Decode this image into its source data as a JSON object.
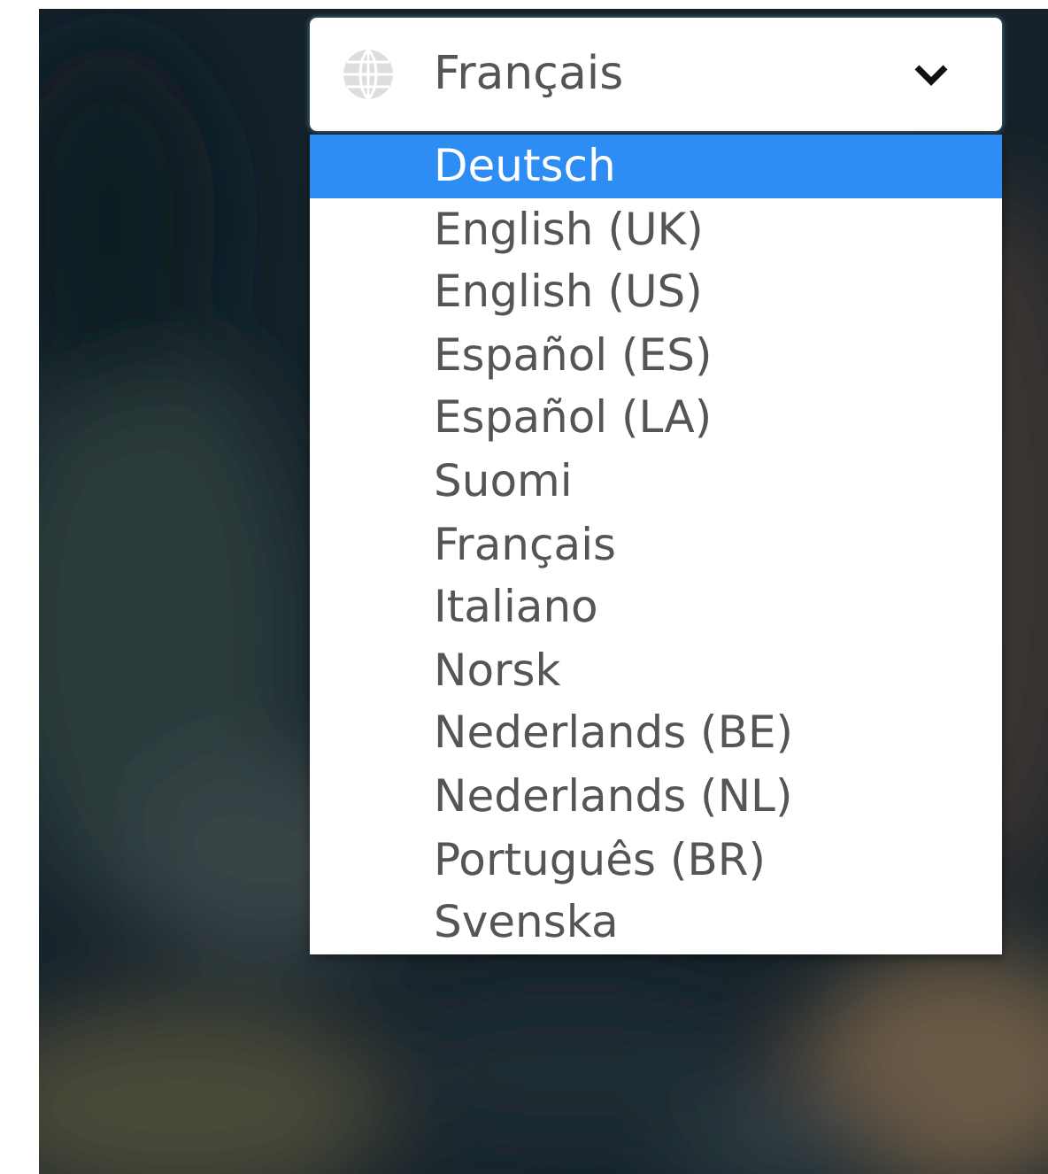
{
  "language_select": {
    "value": "Français",
    "expanded": true,
    "options": [
      {
        "label": "Deutsch",
        "highlighted": true
      },
      {
        "label": "English (UK)",
        "highlighted": false
      },
      {
        "label": "English (US)",
        "highlighted": false
      },
      {
        "label": "Español (ES)",
        "highlighted": false
      },
      {
        "label": "Español (LA)",
        "highlighted": false
      },
      {
        "label": "Suomi",
        "highlighted": false
      },
      {
        "label": "Français",
        "highlighted": false
      },
      {
        "label": "Italiano",
        "highlighted": false
      },
      {
        "label": "Norsk",
        "highlighted": false
      },
      {
        "label": "Nederlands (BE)",
        "highlighted": false
      },
      {
        "label": "Nederlands (NL)",
        "highlighted": false
      },
      {
        "label": "Português (BR)",
        "highlighted": false
      },
      {
        "label": "Svenska",
        "highlighted": false
      }
    ]
  }
}
